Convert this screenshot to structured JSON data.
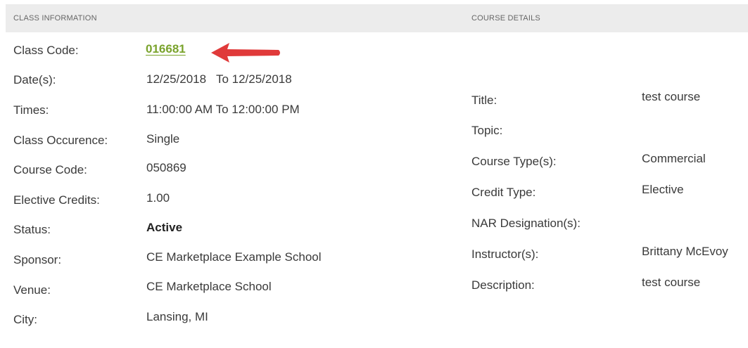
{
  "class_info": {
    "heading": "CLASS INFORMATION",
    "class_code_label": "Class Code:",
    "class_code_value": "016681",
    "dates_label": "Date(s):",
    "dates_value": "12/25/2018   To 12/25/2018",
    "times_label": "Times:",
    "times_value": "11:00:00 AM To 12:00:00 PM",
    "occurrence_label": "Class Occurence:",
    "occurrence_value": "Single",
    "course_code_label": "Course Code:",
    "course_code_value": "050869",
    "elective_credits_label": "Elective Credits:",
    "elective_credits_value": "1.00",
    "status_label": "Status:",
    "status_value": "Active",
    "sponsor_label": "Sponsor:",
    "sponsor_value": "CE Marketplace Example School",
    "venue_label": "Venue:",
    "venue_value": "CE Marketplace School",
    "city_label": "City:",
    "city_value": "Lansing, MI"
  },
  "course_details": {
    "heading": "COURSE DETAILS",
    "title_label": "Title:",
    "title_value": "test course",
    "topic_label": "Topic:",
    "topic_value": "",
    "course_type_label": "Course Type(s):",
    "course_type_value": "Commercial",
    "credit_type_label": "Credit Type:",
    "credit_type_value": "Elective",
    "nar_label": "NAR Designation(s):",
    "nar_value": "",
    "instructor_label": "Instructor(s):",
    "instructor_value": "Brittany McEvoy",
    "description_label": "Description:",
    "description_value": "test course"
  },
  "colors": {
    "link": "#7aa32c",
    "arrow": "#e03a3a",
    "header_bg": "#ececec"
  },
  "icons": {
    "annotation": "red-arrow-icon"
  }
}
